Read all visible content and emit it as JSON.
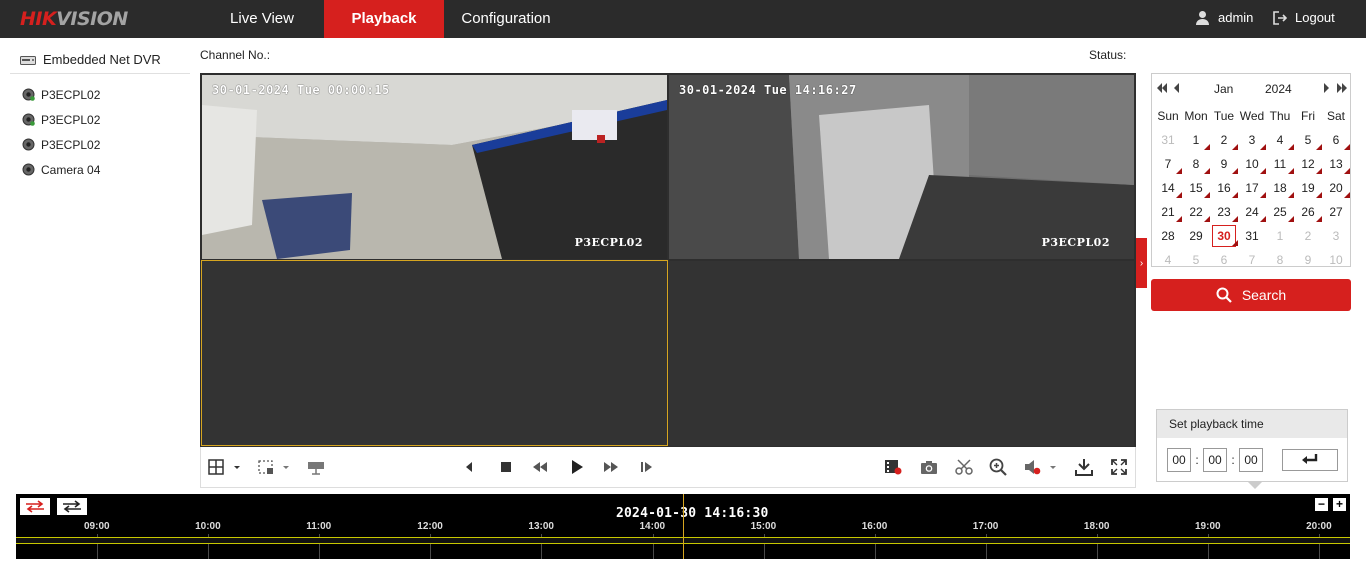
{
  "brand": {
    "logo_main": "HIK",
    "logo_rest": "VISION"
  },
  "nav": {
    "live_view": "Live View",
    "playback": "Playback",
    "configuration": "Configuration"
  },
  "user": {
    "name": "admin",
    "logout": "Logout"
  },
  "device_tree": {
    "root": "Embedded Net DVR",
    "cameras": [
      "P3ECPL02",
      "P3ECPL02",
      "P3ECPL02",
      "Camera 04"
    ]
  },
  "header": {
    "channel_label": "Channel No.:",
    "status_label": "Status:"
  },
  "video": {
    "pane1": {
      "osd_time": "30-01-2024 Tue 00:00:15",
      "osd_name": "P3ECPL02"
    },
    "pane2": {
      "osd_time": "30-01-2024 Tue 14:16:27",
      "osd_name": "P3ECPL02"
    }
  },
  "calendar": {
    "month": "Jan",
    "year": "2024",
    "weekdays": [
      "Sun",
      "Mon",
      "Tue",
      "Wed",
      "Thu",
      "Fri",
      "Sat"
    ],
    "weeks": [
      [
        {
          "d": "31",
          "m": true
        },
        {
          "d": "1",
          "r": true
        },
        {
          "d": "2",
          "r": true
        },
        {
          "d": "3",
          "r": true
        },
        {
          "d": "4",
          "r": true
        },
        {
          "d": "5",
          "r": true
        },
        {
          "d": "6",
          "r": true
        }
      ],
      [
        {
          "d": "7",
          "r": true
        },
        {
          "d": "8",
          "r": true
        },
        {
          "d": "9",
          "r": true
        },
        {
          "d": "10",
          "r": true
        },
        {
          "d": "11",
          "r": true
        },
        {
          "d": "12",
          "r": true
        },
        {
          "d": "13",
          "r": true
        }
      ],
      [
        {
          "d": "14",
          "r": true
        },
        {
          "d": "15",
          "r": true
        },
        {
          "d": "16",
          "r": true
        },
        {
          "d": "17",
          "r": true
        },
        {
          "d": "18",
          "r": true
        },
        {
          "d": "19",
          "r": true
        },
        {
          "d": "20",
          "r": true
        }
      ],
      [
        {
          "d": "21",
          "r": true
        },
        {
          "d": "22",
          "r": true
        },
        {
          "d": "23",
          "r": true
        },
        {
          "d": "24",
          "r": true
        },
        {
          "d": "25",
          "r": true
        },
        {
          "d": "26",
          "r": true
        },
        {
          "d": "27"
        }
      ],
      [
        {
          "d": "28"
        },
        {
          "d": "29"
        },
        {
          "d": "30",
          "s": true,
          "r": true
        },
        {
          "d": "31"
        },
        {
          "d": "1",
          "m": true
        },
        {
          "d": "2",
          "m": true
        },
        {
          "d": "3",
          "m": true
        }
      ],
      [
        {
          "d": "4",
          "m": true
        },
        {
          "d": "5",
          "m": true
        },
        {
          "d": "6",
          "m": true
        },
        {
          "d": "7",
          "m": true
        },
        {
          "d": "8",
          "m": true
        },
        {
          "d": "9",
          "m": true
        },
        {
          "d": "10",
          "m": true
        }
      ]
    ]
  },
  "search": {
    "label": "Search"
  },
  "playback_time": {
    "title": "Set playback time",
    "hh": "00",
    "mm": "00",
    "ss": "00"
  },
  "timeline": {
    "current": "2024-01-30 14:16:30",
    "hours": [
      "09:00",
      "10:00",
      "11:00",
      "12:00",
      "13:00",
      "14:00",
      "15:00",
      "16:00",
      "17:00",
      "18:00",
      "19:00",
      "20:00"
    ]
  },
  "colors": {
    "accent": "#d6201e",
    "topbar": "#2b2b2b",
    "selected_pane": "#d6a520"
  }
}
